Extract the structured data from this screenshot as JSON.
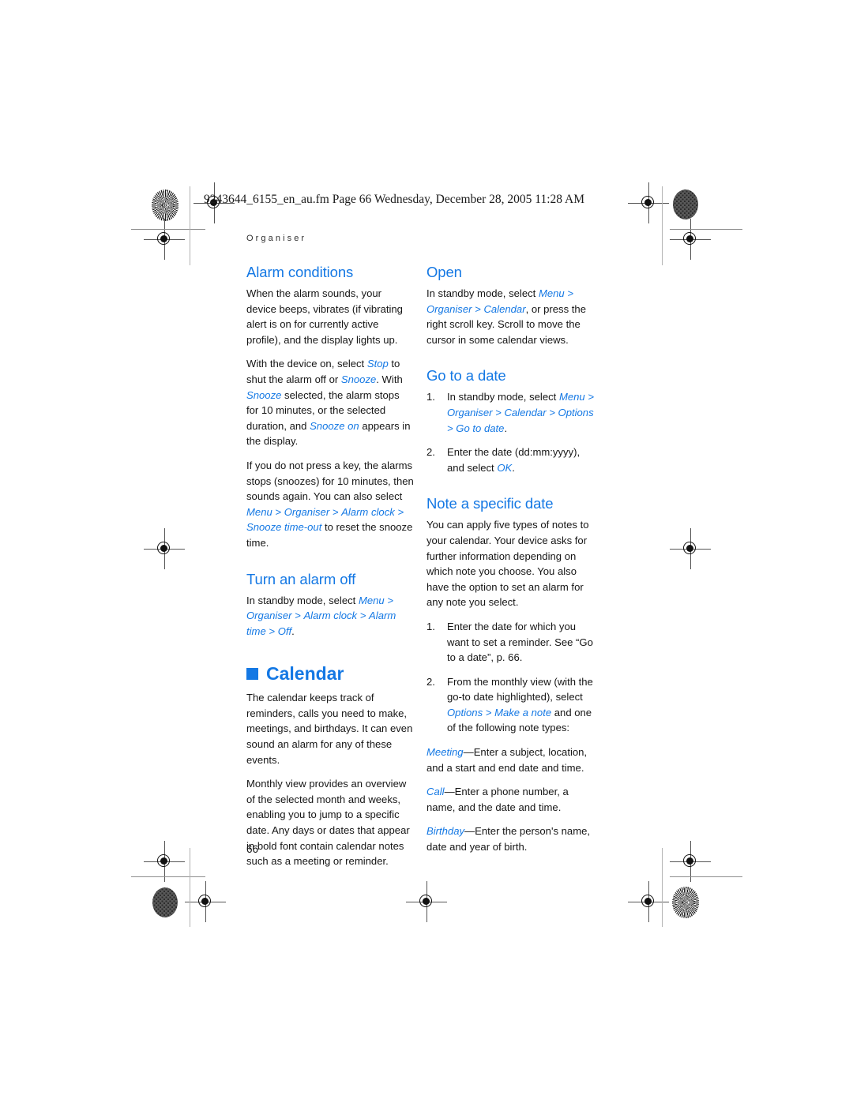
{
  "page": {
    "file_header": "9243644_6155_en_au.fm  Page 66  Wednesday, December 28, 2005  11:28 AM",
    "running_head": "Organiser",
    "page_number": "66",
    "accent_color": "#1478e4",
    "text_color": "#161616"
  },
  "left_column": {
    "alarm_conditions": {
      "heading": "Alarm conditions",
      "p1": "When the alarm sounds, your device beeps, vibrates (if vibrating alert is on for currently active profile), and the display lights up.",
      "p2_a": "With the device on, select ",
      "p2_ui1": "Stop",
      "p2_b": " to shut the alarm off or ",
      "p2_ui2": "Snooze",
      "p2_c": ". With ",
      "p2_ui3": "Snooze",
      "p2_d": " selected, the alarm stops for 10 minutes, or the selected duration, and ",
      "p2_ui4": "Snooze on",
      "p2_e": " appears in the display.",
      "p3_a": "If you do not press a key, the alarms stops (snoozes) for 10 minutes, then sounds again. You can also select ",
      "p3_ui1": "Menu",
      "p3_ui2": "Organiser",
      "p3_ui3": "Alarm clock",
      "p3_ui4": "Snooze time-out",
      "p3_b": " to reset the snooze time."
    },
    "turn_alarm_off": {
      "heading": "Turn an alarm off",
      "p1_a": "In standby mode, select ",
      "p1_ui1": "Menu",
      "p1_ui2": "Organiser",
      "p1_ui3": "Alarm clock",
      "p1_ui4": "Alarm time",
      "p1_ui5": "Off",
      "p1_b": "."
    },
    "calendar": {
      "heading": "Calendar",
      "p1": "The calendar keeps track of reminders, calls you need to make, meetings, and birthdays. It can even sound an alarm for any of these events.",
      "p2": "Monthly view provides an overview of the selected month and weeks, enabling you to jump to a specific date. Any days or dates that appear in bold font contain calendar notes such as a meeting or reminder."
    }
  },
  "right_column": {
    "open": {
      "heading": "Open",
      "p1_a": "In standby mode, select ",
      "p1_ui1": "Menu",
      "p1_ui2": "Organiser",
      "p1_ui3": "Calendar",
      "p1_b": ", or press the right scroll key. Scroll to move the cursor in some calendar views."
    },
    "go_to_date": {
      "heading": "Go to a date",
      "step1_a": "In standby mode, select ",
      "step1_ui1": "Menu",
      "step1_ui2": "Organiser",
      "step1_ui3": "Calendar",
      "step1_ui4": "Options",
      "step1_ui5": "Go to date",
      "step1_b": ".",
      "step2_a": "Enter the date (dd:mm:yyyy), and select ",
      "step2_ui1": "OK",
      "step2_b": "."
    },
    "note_specific_date": {
      "heading": "Note a specific date",
      "p1": "You can apply five types of notes to your calendar. Your device asks for further information depending on which note you choose. You also have the option to set an alarm for any note you select.",
      "step1": "Enter the date for which you want to set a reminder. See “Go to a date”, p. 66.",
      "step2_a": "From the monthly view (with the go-to date highlighted), select ",
      "step2_ui1": "Options",
      "step2_ui2": "Make a note",
      "step2_b": " and one of the following note types:",
      "note_meeting_ui": "Meeting",
      "note_meeting_text": "—Enter a subject, location, and a start and end date and time.",
      "note_call_ui": "Call",
      "note_call_text": "—Enter a phone number, a name, and the date and time.",
      "note_birthday_ui": "Birthday",
      "note_birthday_text": "—Enter the person's name, date and year of birth."
    }
  },
  "symbols": {
    "gt": ">"
  }
}
